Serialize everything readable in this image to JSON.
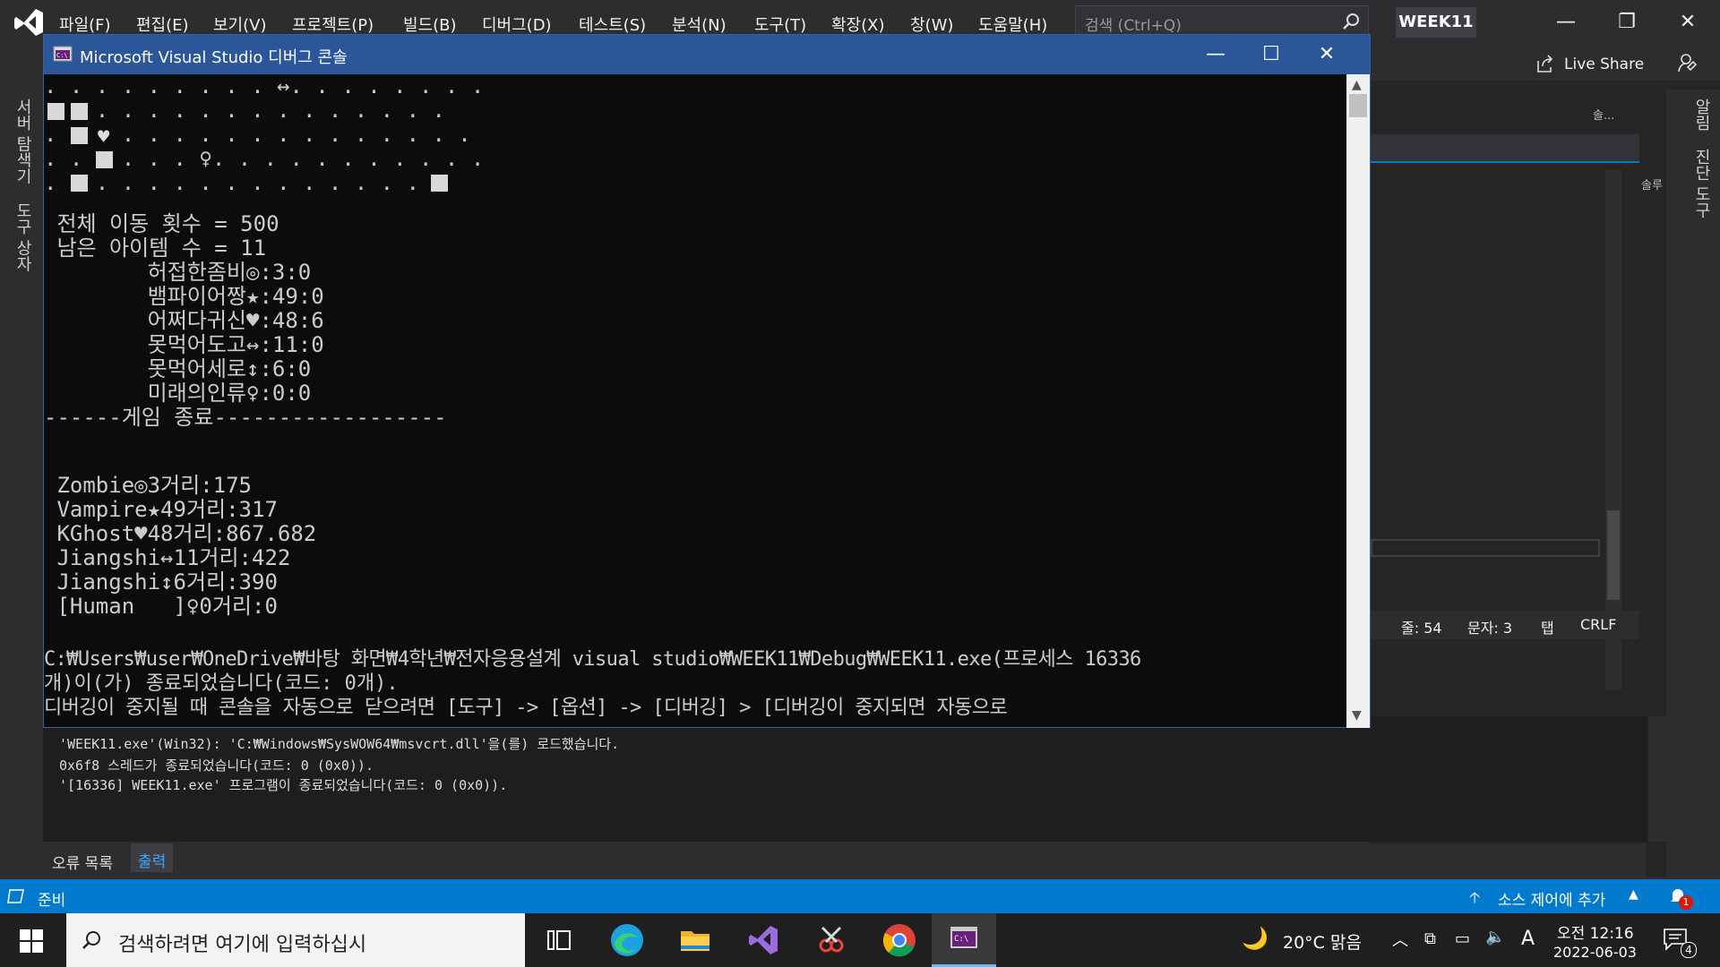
{
  "vs": {
    "menu": [
      "파일(F)",
      "편집(E)",
      "보기(V)",
      "프로젝트(P)",
      "빌드(B)",
      "디버그(D)",
      "테스트(S)",
      "분석(N)",
      "도구(T)",
      "확장(X)",
      "창(W)",
      "도움말(H)"
    ],
    "search_placeholder": "검색 (Ctrl+Q)",
    "solution_name": "WEEK11",
    "live_share": "Live Share",
    "left_tabs": [
      "서버 탐색기",
      "도구 상자"
    ],
    "right_tabs": [
      "알림",
      "진단 도구"
    ],
    "right_panel_title": "솔...",
    "right_panel_tab": "솔루",
    "editor_status": {
      "line": "줄: 54",
      "col": "문자: 3",
      "tab": "탭",
      "eol": "CRLF"
    }
  },
  "console": {
    "title": "Microsoft Visual Studio 디버그 콘솔",
    "grid_rows": [
      ". . . . . . . . . ↔. . . . . . . .",
      "  . . . . . . . . . . . . . . . .",
      ". ",
      ". . . . . . . ♀. . . . . . . . . .",
      ". . . . . . . . . . . . . . . . ."
    ],
    "hearts_row": "♥. . . . . . . . . . . . . .",
    "summary": [
      " 전체 이동 횟수 = 500",
      " 남은 아이템 수 = 11",
      "        허접한좀비◎:3:0",
      "        뱀파이어짱★:49:0",
      "        어쩌다귀신♥:48:6",
      "        못먹어도고↔:11:0",
      "        못먹어세로↕:6:0",
      "        미래의인류♀:0:0",
      "------게임 종료------------------"
    ],
    "results": [
      " Zombie◎3거리:175",
      " Vampire★49거리:317",
      " KGhost♥48거리:867.682",
      " Jiangshi↔11거리:422",
      " Jiangshi↕6거리:390",
      " [Human   ]♀0거리:0"
    ],
    "exit_lines": [
      "C:₩Users₩user₩OneDrive₩바탕 화면₩4학년₩전자응용설계 visual studio₩WEEK11₩Debug₩WEEK11.exe(프로세스 16336",
      "개)이(가) 종료되었습니다(코드: 0개).",
      "디버깅이 중지될 때 콘솔을 자동으로 닫으려면 [도구] -> [옵션] -> [디버깅] > [디버깅이 중지되면 자동으로"
    ]
  },
  "output": {
    "lines": [
      "'WEEK11.exe'(Win32): 'C:₩Windows₩SysWOW64₩msvcrt.dll'을(를) 로드했습니다.",
      "0x6f8 스레드가 종료되었습니다(코드: 0 (0x0)).",
      "'[16336] WEEK11.exe' 프로그램이 종료되었습니다(코드: 0 (0x0))."
    ],
    "tabs": [
      "오류 목록",
      "출력"
    ]
  },
  "status_bar": {
    "ready": "준비",
    "source_control": "소스 제어에 추가",
    "notif_count": "1"
  },
  "taskbar": {
    "search_placeholder": "검색하려면 여기에 입력하십시",
    "weather": "20°C 맑음",
    "ime": "A",
    "time": "오전 12:16",
    "date": "2022-06-03",
    "action_count": "4"
  }
}
